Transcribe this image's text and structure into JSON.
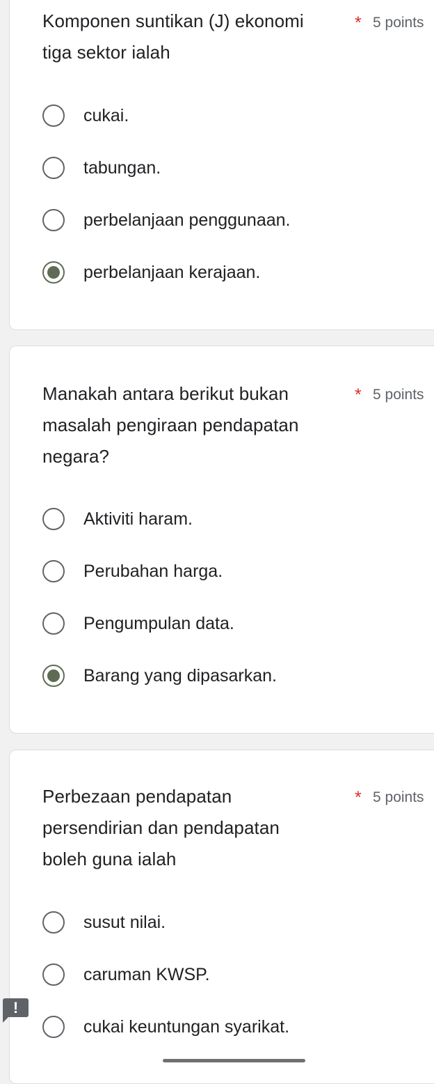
{
  "questions": [
    {
      "text": "Komponen suntikan (J) ekonomi\ntiga sektor ialah",
      "required_mark": "*",
      "points": "5 points",
      "options": [
        {
          "label": "cukai.",
          "selected": false
        },
        {
          "label": "tabungan.",
          "selected": false
        },
        {
          "label": "perbelanjaan penggunaan.",
          "selected": false
        },
        {
          "label": "perbelanjaan kerajaan.",
          "selected": true
        }
      ]
    },
    {
      "text": "Manakah antara berikut bukan\nmasalah pengiraan pendapatan\nnegara?",
      "required_mark": "*",
      "points": "5 points",
      "options": [
        {
          "label": "Aktiviti haram.",
          "selected": false
        },
        {
          "label": "Perubahan harga.",
          "selected": false
        },
        {
          "label": "Pengumpulan data.",
          "selected": false
        },
        {
          "label": "Barang yang dipasarkan.",
          "selected": true
        }
      ]
    },
    {
      "text": "Perbezaan pendapatan\npersendirian dan pendapatan\nboleh guna ialah",
      "required_mark": "*",
      "points": "5 points",
      "options": [
        {
          "label": "susut nilai.",
          "selected": false
        },
        {
          "label": "caruman KWSP.",
          "selected": false
        },
        {
          "label": "cukai keuntungan syarikat.",
          "selected": false
        }
      ]
    }
  ],
  "alert_badge": {
    "text": "!",
    "icon": "alert-flag-icon"
  },
  "colors": {
    "required": "#d93025",
    "selected_radio": "#5f6b55",
    "unselected_radio": "#5f6368",
    "background": "#f1f1f1"
  }
}
